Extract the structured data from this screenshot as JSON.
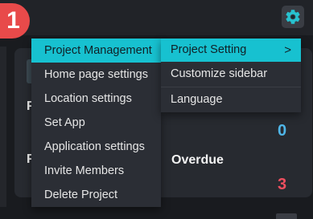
{
  "step_badge": "1",
  "menu": {
    "items": [
      {
        "label": "Project Management",
        "active": true
      },
      {
        "label": "Home page settings"
      },
      {
        "label": "Location settings"
      },
      {
        "label": "Set App"
      },
      {
        "label": "Application settings"
      },
      {
        "label": "Invite Members"
      },
      {
        "label": "Delete Project"
      }
    ]
  },
  "submenu": {
    "items": [
      {
        "label": "Project Setting",
        "chevron": ">",
        "active": true
      },
      {
        "label": "Customize sidebar"
      },
      {
        "label": "Language"
      }
    ]
  },
  "background": {
    "overdue_label": "Overdue",
    "count_top": "0",
    "count_overdue": "3",
    "fragment_left_1": "F",
    "fragment_left_2": "F"
  },
  "colors": {
    "accent": "#17c1d0",
    "badge": "#e84a4a",
    "count_top": "#4fb6e8",
    "count_overdue": "#ee4f5f"
  },
  "icons": {
    "settings": "gear-icon",
    "submenu_arrow": "chevron-right-icon"
  }
}
